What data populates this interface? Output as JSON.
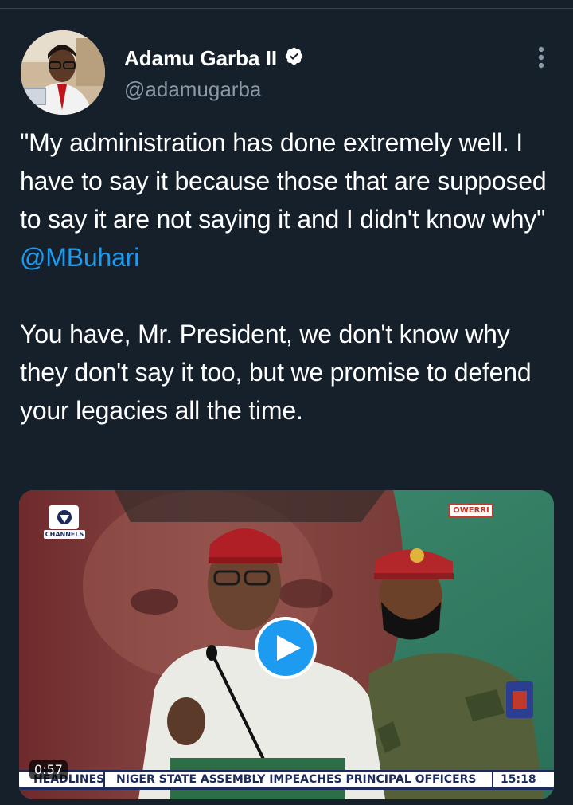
{
  "tweet": {
    "display_name": "Adamu Garba II",
    "handle": "@adamugarba",
    "verified": true,
    "body_line_1": "\"My administration has done extremely well. I have to say it because those that are supposed to say it are not saying it and I didn't know why\" ",
    "mention": "@MBuhari",
    "body_line_2": "You have, Mr. President, we don't know why they don't say it too, but we promise to defend your legacies all the time."
  },
  "video": {
    "broadcaster": "CHANNELS",
    "location_tag": "OWERRI",
    "duration": "0:57",
    "ticker_label": "HEADLINES",
    "ticker_text": "NIGER STATE ASSEMBLY IMPEACHES PRINCIPAL OFFICERS",
    "ticker_time": "15:18"
  },
  "icons": {
    "verified": "verified-badge-icon",
    "more": "more-vertical-icon",
    "play": "play-icon"
  },
  "colors": {
    "background": "#15202b",
    "accent": "#1d9bf0",
    "secondary_text": "#8b98a5",
    "divider": "#38444d"
  }
}
